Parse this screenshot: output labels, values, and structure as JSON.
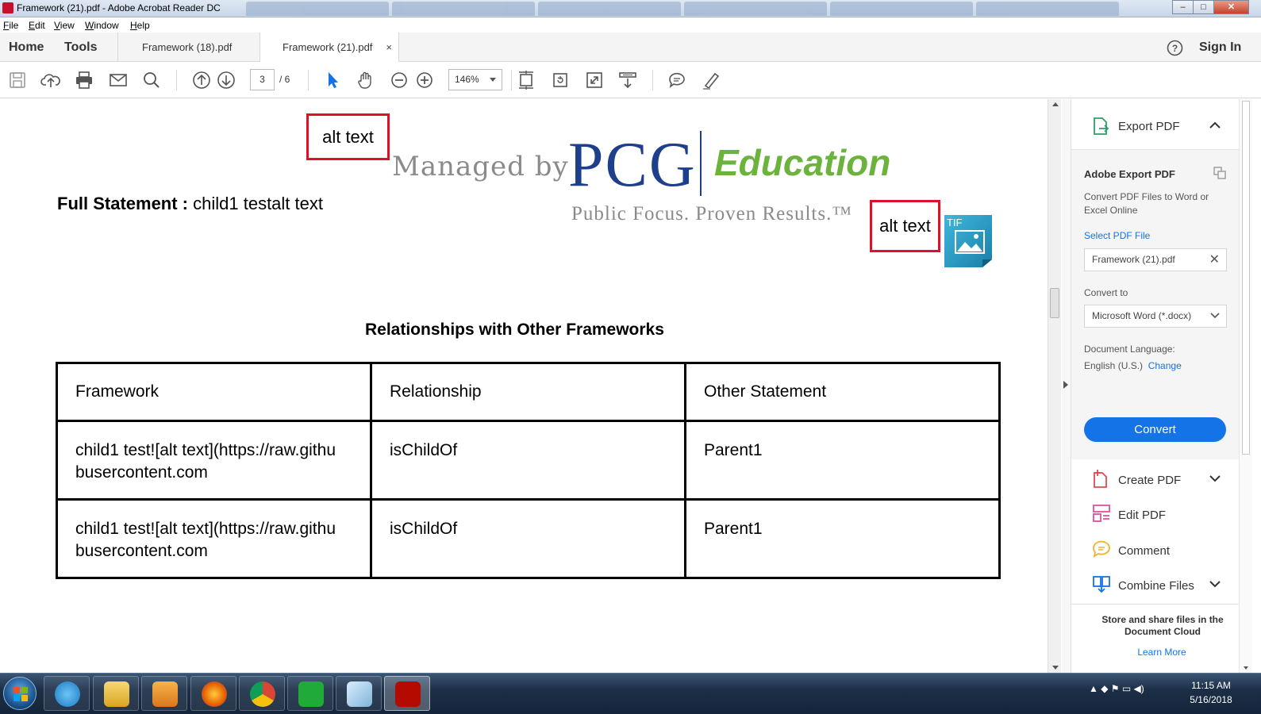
{
  "window": {
    "title": "Framework (21).pdf - Adobe Acrobat Reader DC",
    "controls": {
      "minimize": "–",
      "maximize": "□",
      "close": "✕"
    }
  },
  "menu": {
    "items": [
      "File",
      "Edit",
      "View",
      "Window",
      "Help"
    ]
  },
  "tabs": {
    "home": "Home",
    "tools": "Tools",
    "documents": [
      {
        "label": "Framework (18).pdf",
        "active": false
      },
      {
        "label": "Framework (21).pdf",
        "active": true,
        "close": "×"
      }
    ],
    "help_icon": "help-icon",
    "sign_in": "Sign In"
  },
  "toolbar": {
    "icons": [
      "save-icon",
      "upload-icon",
      "print-icon",
      "email-icon",
      "search-icon",
      "prev-page-icon",
      "next-page-icon",
      "select-cursor-icon",
      "hand-icon",
      "zoom-out-icon",
      "zoom-in-icon",
      "fit-page-icon",
      "rotate-icon",
      "full-screen-icon",
      "scroll-mode-icon",
      "comment-icon",
      "highlight-icon"
    ],
    "current_page": "3",
    "total_pages": "/ 6",
    "zoom": "146%"
  },
  "document": {
    "alt_text_top": "alt text",
    "alt_text_right": "alt text",
    "logo": {
      "managed_by": "Managed by",
      "pcg": "PCG",
      "education": "Education",
      "tagline": "Public Focus. Proven Results.™"
    },
    "full_statement_label": "Full Statement :",
    "full_statement_value": " child1 testalt text",
    "tif_label": "TIF",
    "relationships_heading": "Relationships with Other Frameworks",
    "table": {
      "headers": [
        "Framework",
        "Relationship",
        "Other Statement"
      ],
      "rows": [
        [
          "child1 test![alt text](https://raw.githu busercontent.com",
          "isChildOf",
          "Parent1"
        ],
        [
          "child1 test![alt text](https://raw.githu busercontent.com",
          "isChildOf",
          "Parent1"
        ]
      ]
    }
  },
  "right_panel": {
    "export_pdf": "Export PDF",
    "adobe_export_title": "Adobe Export PDF",
    "description": "Convert PDF Files to Word or Excel Online",
    "select_pdf_file": "Select PDF File",
    "selected_file": "Framework (21).pdf",
    "convert_to_label": "Convert to",
    "convert_to_value": "Microsoft Word (*.docx)",
    "doc_language_label": "Document Language:",
    "doc_language_value": "English (U.S.)",
    "change": "Change",
    "convert_button": "Convert",
    "tools": [
      "Create PDF",
      "Edit PDF",
      "Comment",
      "Combine Files"
    ],
    "cloud_text": "Store and share files in the Document Cloud",
    "learn_more": "Learn More"
  },
  "taskbar": {
    "apps": [
      "internet-explorer",
      "file-explorer",
      "media-player",
      "firefox",
      "chrome",
      "green-app",
      "notes-app",
      "acrobat-reader"
    ],
    "time": "11:15 AM",
    "date": "5/16/2018"
  },
  "colors": {
    "accent_blue": "#1473e6",
    "alt_text_border": "#e0102a",
    "pcg_blue": "#1e3f8c",
    "education_green": "#6cb33e"
  }
}
